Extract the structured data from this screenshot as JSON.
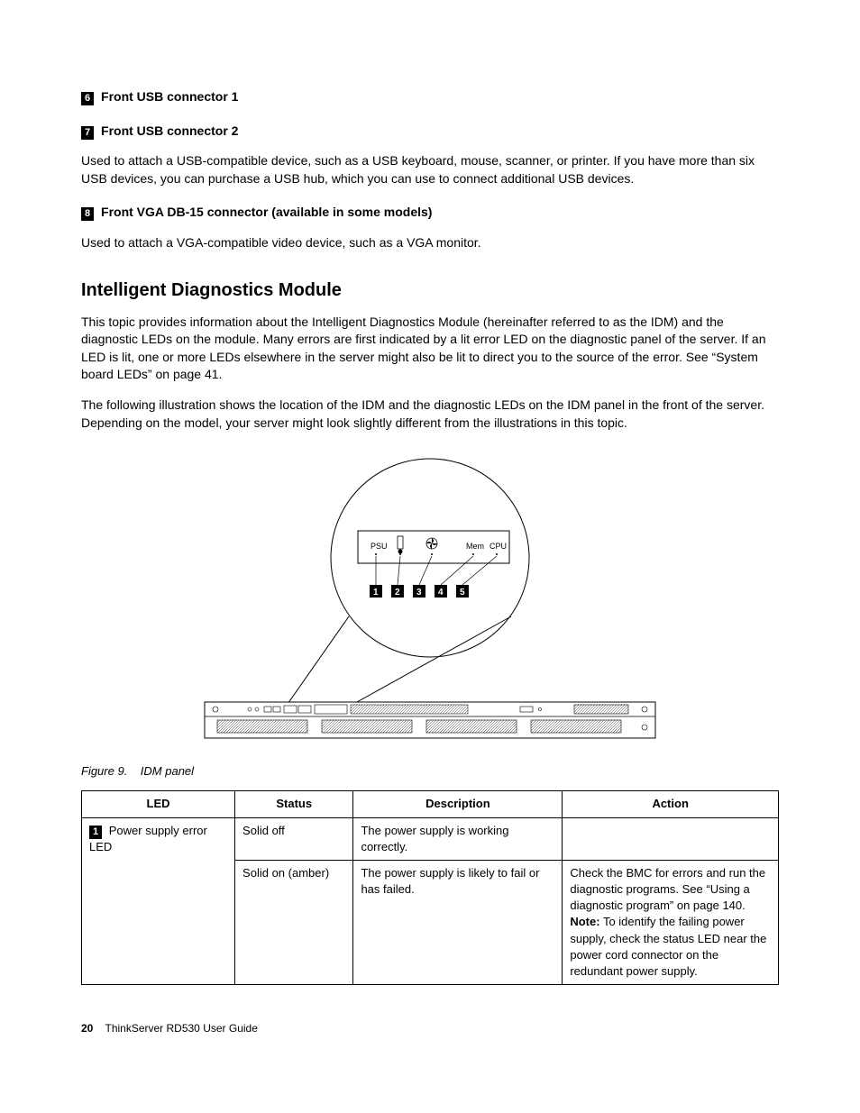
{
  "item6": {
    "num": "6",
    "title": "Front USB connector 1"
  },
  "item7": {
    "num": "7",
    "title": "Front USB connector 2"
  },
  "usb_desc": "Used to attach a USB-compatible device, such as a USB keyboard, mouse, scanner, or printer. If you have more than six USB devices, you can purchase a USB hub, which you can use to connect additional USB devices.",
  "item8": {
    "num": "8",
    "title": "Front VGA DB-15 connector (available in some models)"
  },
  "vga_desc": "Used to attach a VGA-compatible video device, such as a VGA monitor.",
  "h2": "Intelligent Diagnostics Module",
  "idm_p1": "This topic provides information about the Intelligent Diagnostics Module (hereinafter referred to as the IDM) and the diagnostic LEDs on the module. Many errors are first indicated by a lit error LED on the diagnostic panel of the server. If an LED is lit, one or more LEDs elsewhere in the server might also be lit to direct you to the source of the error. See “System board LEDs” on page 41.",
  "idm_p2": "The following illustration shows the location of the IDM and the diagnostic LEDs on the IDM panel in the front of the server. Depending on the model, your server might look slightly different from the illustrations in this topic.",
  "fig": {
    "label": "Figure 9.",
    "caption": "IDM panel"
  },
  "panel": {
    "lbl1": "PSU",
    "lbl4": "Mem",
    "lbl5": "CPU",
    "c1": "1",
    "c2": "2",
    "c3": "3",
    "c4": "4",
    "c5": "5"
  },
  "thead": {
    "c1": "LED",
    "c2": "Status",
    "c3": "Description",
    "c4": "Action"
  },
  "row1": {
    "led_num": "1",
    "led_name": "Power supply error LED",
    "status": "Solid off",
    "desc": "The power supply is working correctly.",
    "action": ""
  },
  "row2": {
    "status": "Solid on (amber)",
    "desc": "The power supply is likely to fail or has failed.",
    "action_p1": "Check the BMC for errors and run the diagnostic programs. See “Using a diagnostic program” on page 140.",
    "action_note_label": "Note:",
    "action_note": " To identify the failing power supply, check the status LED near the power cord connector on the redundant power supply."
  },
  "footer": {
    "page": "20",
    "doc": "ThinkServer RD530 User Guide"
  }
}
